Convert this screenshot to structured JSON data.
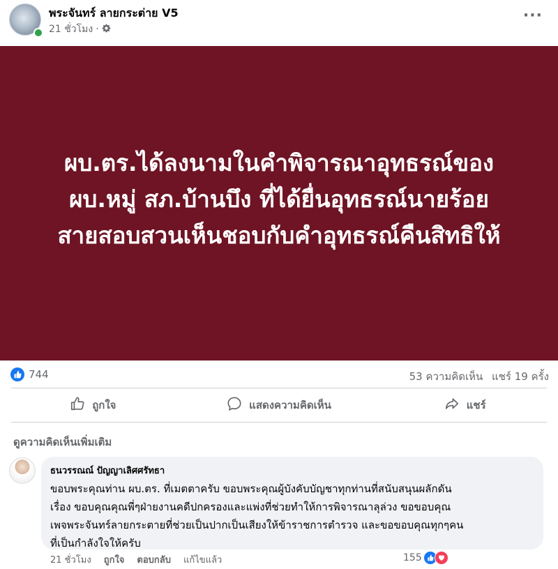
{
  "post": {
    "page_name": "พระจันทร์ ลายกระต่าย V5",
    "time": "21 ชั่วโมง",
    "separator": "·",
    "banner_lines": [
      "ผบ.ตร.ได้ลงนามในคำพิจารณาอุทธรณ์ของ",
      "ผบ.หมู่ สภ.บ้านบึง ที่ได้ยื่นอุทธรณ์นายร้อย",
      "สายสอบสวนเห็นชอบกับคำอุทธรณ์คืนสิทธิให้"
    ],
    "banner_color": "#6e1424"
  },
  "stats": {
    "reactions": "744",
    "comments": "53 ความคิดเห็น",
    "shares": "แชร์ 19 ครั้ง"
  },
  "actions": {
    "like": "ถูกใจ",
    "comment": "แสดงความคิดเห็น",
    "share": "แชร์"
  },
  "comments_section": {
    "more_label": "ดูความคิดเห็นเพิ่มเติม",
    "comment": {
      "author": "ธนวรรณณ์ ปัญญาเลิศศรัทธา",
      "lines": [
        "ขอบพระคุณท่าน ผบ.ตร. ที่เมตตาครับ ขอบพระคุณผู้บังคับบัญชาทุกท่านที่สนับสนุนผลักดัน",
        "เรื่อง ขอบคุณคุณพี่ๆฝ่ายงานคดีปกครองและแพ่งที่ช่วยทำให้การพิจารณาลุล่วง ขอขอบคุณ",
        "เพจพระจันทร์ลายกระตายที่ช่วยเป็นปากเป็นเสียงให้ข้าราชการตำรวจ และขอขอบคุณทุกๆคน",
        "ที่เป็นกำลังใจให้ครับ"
      ],
      "time": "21 ชั่วโมง",
      "like": "ถูกใจ",
      "reply": "ตอบกลับ",
      "edited": "แก้ไขแล้ว",
      "reactions": "155"
    }
  }
}
